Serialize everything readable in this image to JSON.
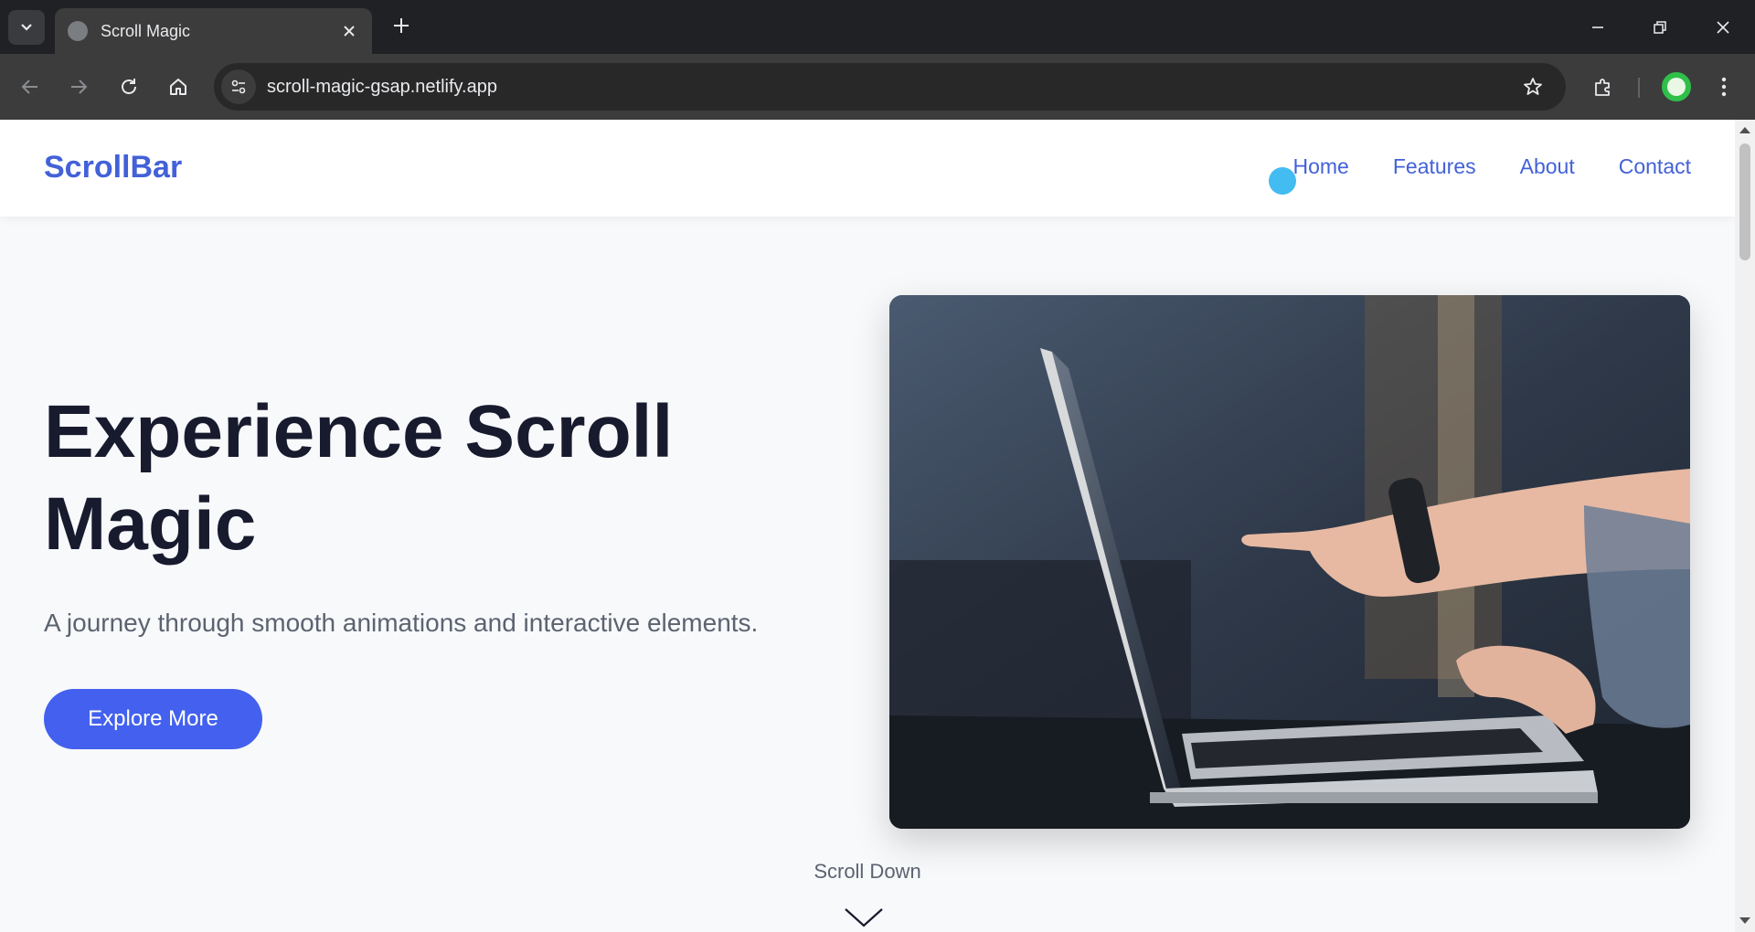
{
  "browser": {
    "tab_title": "Scroll Magic",
    "url": "scroll-magic-gsap.netlify.app"
  },
  "site": {
    "brand": "ScrollBar",
    "nav": [
      "Home",
      "Features",
      "About",
      "Contact"
    ]
  },
  "hero": {
    "title_line1": "Experience Scroll",
    "title_line2": "Magic",
    "subtitle": "A journey through smooth animations and interactive elements.",
    "cta_label": "Explore More",
    "scroll_hint": "Scroll Down"
  },
  "colors": {
    "accent": "#4361ee",
    "brand_text": "#4361d8",
    "heading": "#181a2e",
    "cursor": "#39b8f0"
  }
}
